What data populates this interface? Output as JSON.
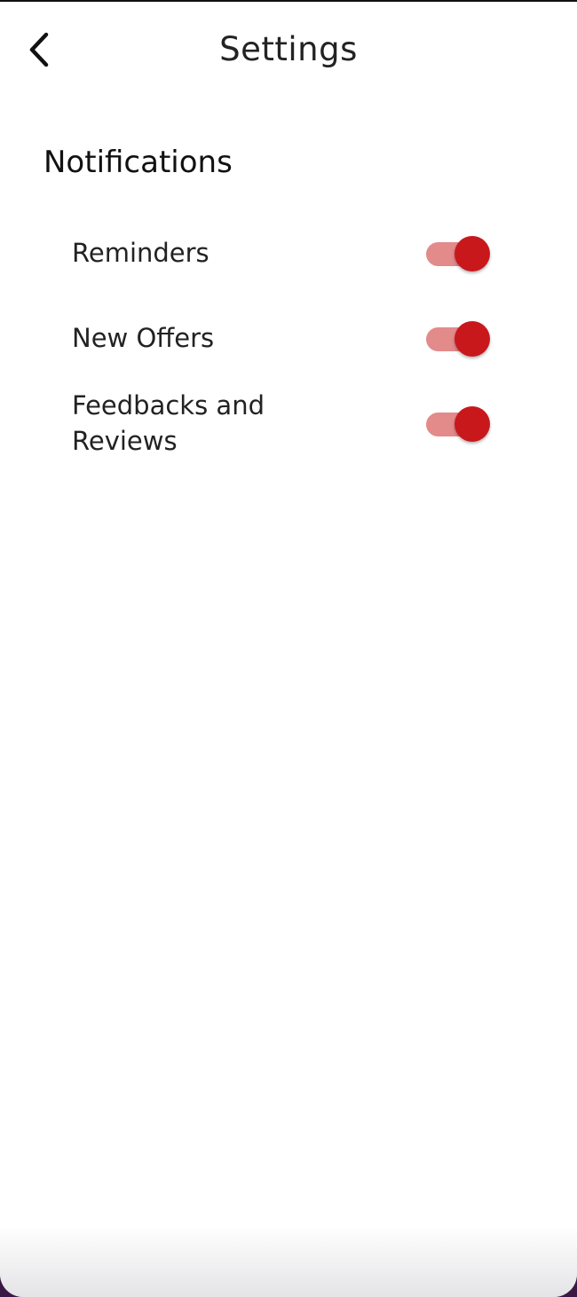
{
  "header": {
    "title": "Settings",
    "back_icon": "chevron-left-icon"
  },
  "notifications": {
    "section_title": "Notifications",
    "items": [
      {
        "label": "Reminders",
        "enabled": true
      },
      {
        "label": "New Offers",
        "enabled": true
      },
      {
        "label": "Feedbacks and Reviews",
        "enabled": true
      }
    ]
  },
  "colors": {
    "toggle_on_thumb": "#c8181c",
    "toggle_on_track": "#e38a8b",
    "background": "#ffffff",
    "text": "#222222"
  }
}
